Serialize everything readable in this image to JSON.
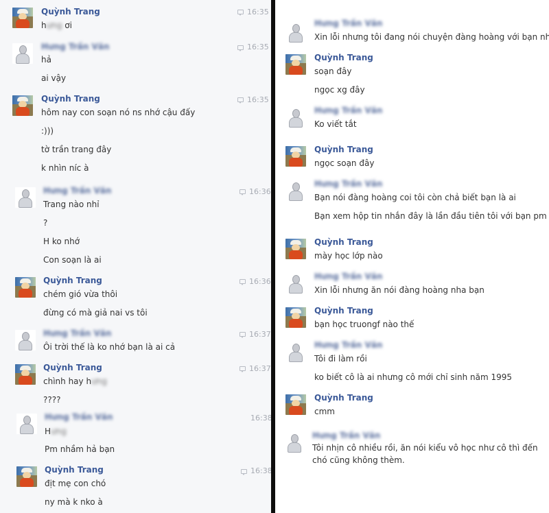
{
  "participants": {
    "quynh_trang": "Quỳnh Trang",
    "hung_tran_van": "Hưng Trần Văn"
  },
  "left": {
    "g1": {
      "time": "16:35",
      "m1_pre": "h",
      "m1_blur": "ưng",
      "m1_post": " ơi"
    },
    "g2": {
      "time": "16:35",
      "m1": "hả",
      "m2": "ai vậy"
    },
    "g3": {
      "time": "16:35",
      "m1": "hôm nay con soạn nó ns nhớ cậu đấy",
      "m2": ":)))",
      "m3": "tờ trần trang đây",
      "m4": "k nhìn níc à"
    },
    "g4": {
      "time": "16:36",
      "m1": "Trang nào nhỉ",
      "m2": "?",
      "m3": "H ko nhớ",
      "m4": "Con soạn là ai"
    },
    "g5": {
      "time": "16:36",
      "m1": "chém gió vừa thôi",
      "m2": "đừng có mà giả nai vs tôi"
    },
    "g6": {
      "time": "16:37",
      "m1": "Ôi trời thế là ko nhớ bạn là ai cả"
    },
    "g7": {
      "time": "16:37",
      "m1_pre": "chình hay h",
      "m1_blur": "ưng",
      "m2": "????"
    },
    "g8": {
      "time": "16:38",
      "m1_pre": "H",
      "m1_blur": "ưng",
      "m2": "Pm nhầm hả bạn"
    },
    "g9": {
      "time": "16:38",
      "m1": "địt mẹ con chó",
      "m2": "ny mà k nko à"
    }
  },
  "right": {
    "g1": {
      "m1": "Xin lỗi nhưng tôi đang nói chuyện đàng hoàng với bạn nha"
    },
    "g2": {
      "m1": "soạn đây",
      "m2": "ngọc xg đây"
    },
    "g3": {
      "m1": "Ko viết tắt"
    },
    "g4": {
      "m1": "ngọc soạn đây"
    },
    "g5": {
      "m1": "Bạn nói đàng hoàng coi tôi còn chả biết bạn là ai",
      "m2": "Bạn xem hộp tin nhắn đây là lần đầu tiên tôi với bạn pm"
    },
    "g6": {
      "m1": "mày học lớp nào"
    },
    "g7": {
      "m1": "Xin lỗi nhưng ăn nói đàng hoàng nha bạn"
    },
    "g8": {
      "m1": "bạn học truongf nào thế"
    },
    "g9": {
      "m1": "Tôi đi làm rồi",
      "m2": "ko biết cô là ai nhưng cô mới chỉ sinh năm 1995"
    },
    "g10": {
      "m1": "cmm"
    },
    "g11": {
      "m1": "Tôi nhịn cô nhiều rồi, ăn nói kiểu vô học như cô thì đến",
      "m2": "chó cũng không thèm."
    }
  }
}
